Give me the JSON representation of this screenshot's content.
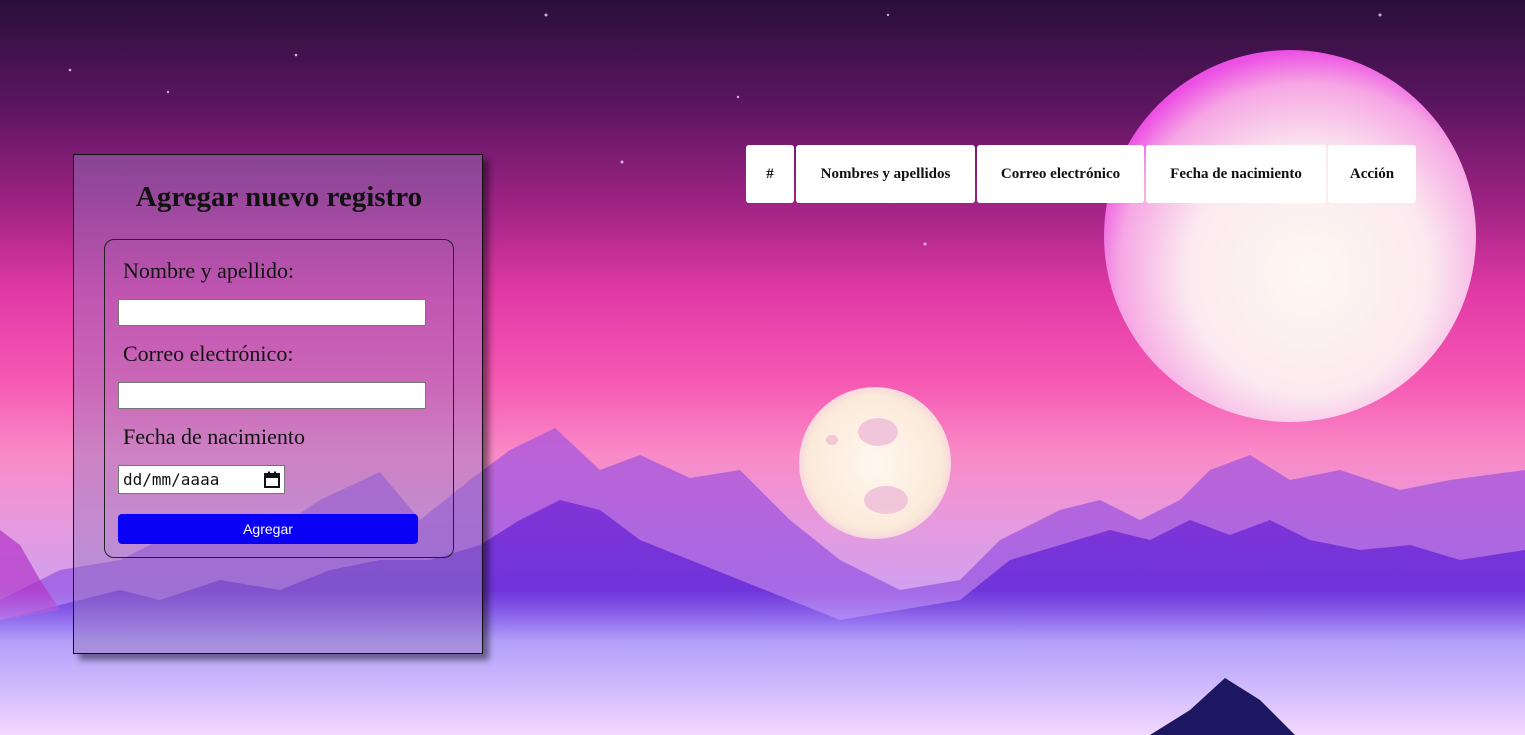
{
  "form": {
    "title": "Agregar nuevo registro",
    "name_label": "Nombre y apellido:",
    "name_value": "",
    "email_label": "Correo electrónico:",
    "email_value": "",
    "birthdate_label": "Fecha de nacimiento",
    "birthdate_placeholder": "dd/mm/aaaa",
    "submit_label": "Agregar"
  },
  "table": {
    "headers": [
      "#",
      "Nombres y apellidos",
      "Correo electrónico",
      "Fecha de nacimiento",
      "Acción"
    ]
  },
  "colors": {
    "button_bg": "#0a00f5",
    "button_text": "#ffffff"
  },
  "icons": {
    "calendar": "calendar-icon"
  }
}
